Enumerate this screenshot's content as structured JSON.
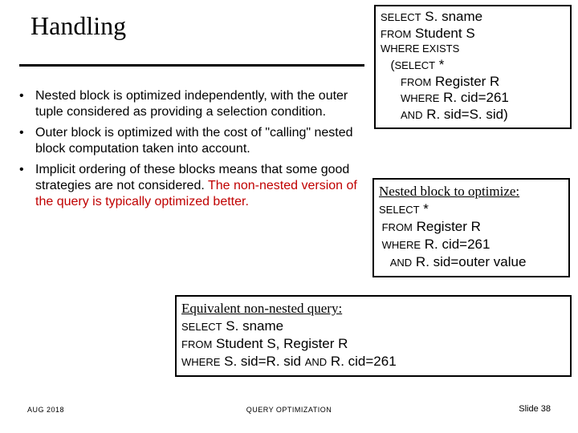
{
  "title": "Handling",
  "bullets": [
    {
      "text": "Nested block is optimized independently, with the outer tuple considered as providing a selection condition."
    },
    {
      "text": "Outer block is optimized with the cost of \"calling\" nested block computation taken into account."
    },
    {
      "text_a": "Implicit ordering of these blocks means that some good strategies are not considered.  ",
      "text_red": "The non-nested version of the query is typically optimized better."
    }
  ],
  "box1": {
    "l1a": "SELECT",
    "l1b": "  S. sname",
    "l2a": "FROM",
    "l2b": "  Student S",
    "l3": "WHERE EXISTS",
    "l4a": "   (",
    "l4b": "SELECT",
    "l4c": "  *",
    "l5a": "      ",
    "l5b": "FROM",
    "l5c": "  Register R",
    "l6a": "      ",
    "l6b": "WHERE",
    "l6c": "  R. cid=261",
    "l7a": "      ",
    "l7b": "AND",
    "l7c": "  R. sid=S. sid)"
  },
  "box2": {
    "hdr": "Nested block to optimize:",
    "l1a": "SELECT",
    "l1b": "  *",
    "l2a": " FROM",
    "l2b": "  Register R",
    "l3a": " WHERE",
    "l3b": "  R. cid=261",
    "l4a": "    AND",
    "l4b": "  R. sid=outer value"
  },
  "box3": {
    "hdr": "Equivalent non-nested query:",
    "l1a": "SELECT",
    "l1b": "  S. sname",
    "l2a": "FROM",
    "l2b": " Student S, Register R",
    "l3a": "WHERE",
    "l3b": "  S. sid=R. sid ",
    "l3c": "AND",
    "l3d": " R. cid=261"
  },
  "footer": {
    "left": "AUG  2018",
    "center": "QUERY  OPTIMIZATION",
    "right": "Slide 38"
  }
}
